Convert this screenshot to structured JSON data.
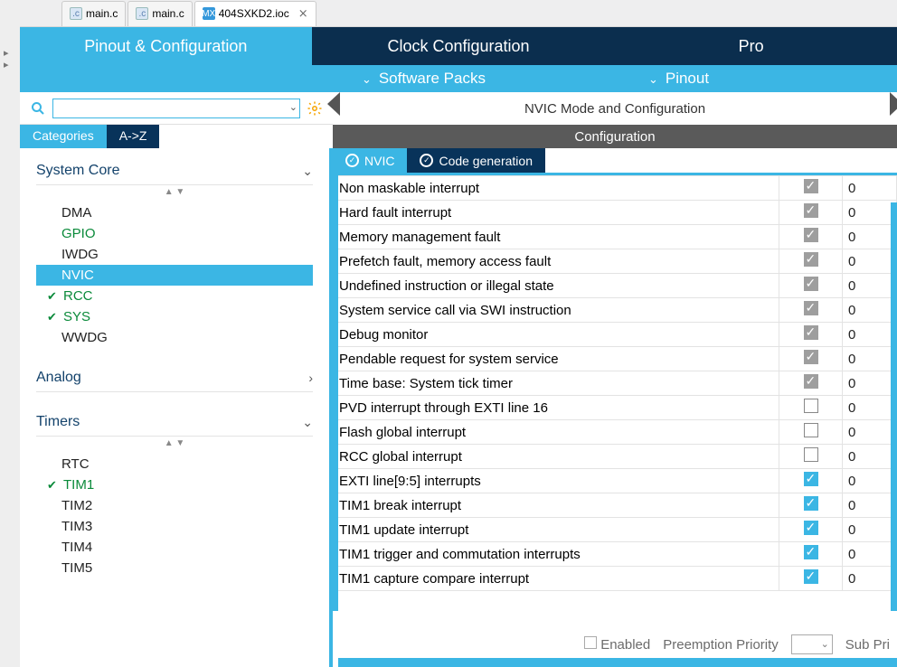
{
  "editor_tabs": [
    {
      "icon": "c",
      "label": "main.c",
      "active": false
    },
    {
      "icon": "c",
      "label": "main.c",
      "active": false
    },
    {
      "icon": "mx",
      "label": "404SXKD2.ioc",
      "active": true
    }
  ],
  "big_tabs": [
    {
      "label": "Pinout & Configuration",
      "active": true
    },
    {
      "label": "Clock Configuration",
      "active": false
    },
    {
      "label": "Pro",
      "active": false
    }
  ],
  "subbar": {
    "left": "Software Packs",
    "right": "Pinout"
  },
  "side_tabs": {
    "active": "Categories",
    "other": "A->Z"
  },
  "categories": [
    {
      "name": "System Core",
      "expanded": true,
      "sorter": true,
      "items": [
        {
          "label": "DMA"
        },
        {
          "label": "GPIO",
          "green": true
        },
        {
          "label": "IWDG"
        },
        {
          "label": "NVIC",
          "selected": true
        },
        {
          "label": "RCC",
          "green": true,
          "checked": true
        },
        {
          "label": "SYS",
          "green": true,
          "checked": true
        },
        {
          "label": "WWDG"
        }
      ]
    },
    {
      "name": "Analog",
      "expanded": false,
      "chev": "›"
    },
    {
      "name": "Timers",
      "expanded": true,
      "sorter": true,
      "items": [
        {
          "label": "RTC"
        },
        {
          "label": "TIM1",
          "green": true,
          "checked": true
        },
        {
          "label": "TIM2"
        },
        {
          "label": "TIM3"
        },
        {
          "label": "TIM4"
        },
        {
          "label": "TIM5"
        }
      ]
    }
  ],
  "rpanel": {
    "title": "NVIC Mode and Configuration",
    "conf_label": "Configuration",
    "inner_tabs": [
      {
        "label": "NVIC",
        "active": true
      },
      {
        "label": "Code generation",
        "active": false
      }
    ],
    "rows": [
      {
        "name": "Non maskable interrupt",
        "state": "gray",
        "pri": "0"
      },
      {
        "name": "Hard fault interrupt",
        "state": "gray",
        "pri": "0"
      },
      {
        "name": "Memory management fault",
        "state": "gray",
        "pri": "0"
      },
      {
        "name": "Prefetch fault, memory access fault",
        "state": "gray",
        "pri": "0"
      },
      {
        "name": "Undefined instruction or illegal state",
        "state": "gray",
        "pri": "0"
      },
      {
        "name": "System service call via SWI instruction",
        "state": "gray",
        "pri": "0"
      },
      {
        "name": "Debug monitor",
        "state": "gray",
        "pri": "0"
      },
      {
        "name": "Pendable request for system service",
        "state": "gray",
        "pri": "0"
      },
      {
        "name": "Time base: System tick timer",
        "state": "gray",
        "pri": "0"
      },
      {
        "name": "PVD interrupt through EXTI line 16",
        "state": "empty",
        "pri": "0"
      },
      {
        "name": "Flash global interrupt",
        "state": "empty",
        "pri": "0"
      },
      {
        "name": "RCC global interrupt",
        "state": "empty",
        "pri": "0"
      },
      {
        "name": "EXTI line[9:5] interrupts",
        "state": "blue",
        "pri": "0"
      },
      {
        "name": "TIM1 break interrupt",
        "state": "blue",
        "pri": "0"
      },
      {
        "name": "TIM1 update interrupt",
        "state": "blue",
        "pri": "0"
      },
      {
        "name": "TIM1 trigger and commutation interrupts",
        "state": "blue",
        "pri": "0"
      },
      {
        "name": "TIM1 capture compare interrupt",
        "state": "blue",
        "pri": "0"
      }
    ],
    "footer": {
      "enabled_label": "Enabled",
      "preemp_label": "Preemption Priority",
      "sub_label": "Sub Pri"
    }
  }
}
